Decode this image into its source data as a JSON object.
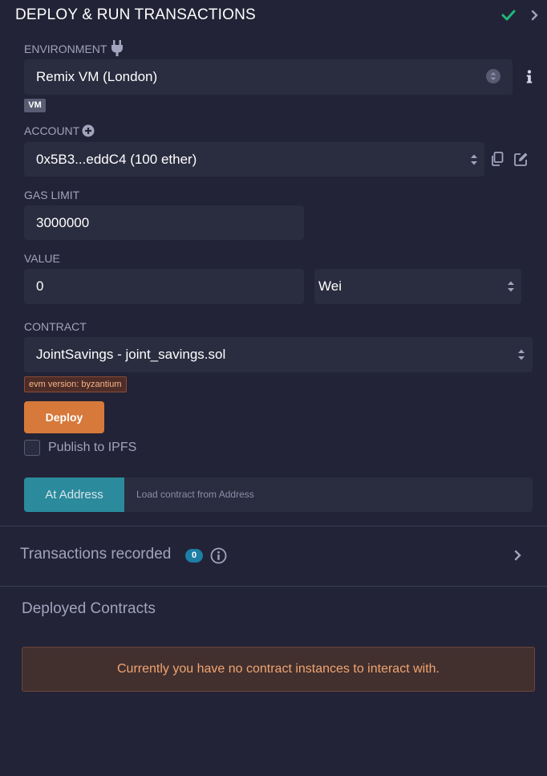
{
  "header": {
    "title": "DEPLOY & RUN TRANSACTIONS"
  },
  "environment": {
    "label": "ENVIRONMENT",
    "value": "Remix VM (London)",
    "badge": "VM"
  },
  "account": {
    "label": "ACCOUNT",
    "value": "0x5B3...eddC4 (100 ether)"
  },
  "gas_limit": {
    "label": "GAS LIMIT",
    "value": "3000000"
  },
  "value": {
    "label": "VALUE",
    "amount": "0",
    "unit": "Wei"
  },
  "contract": {
    "label": "CONTRACT",
    "value": "JointSavings - joint_savings.sol",
    "evm_badge": "evm version: byzantium"
  },
  "deploy": {
    "label": "Deploy",
    "publish_label": "Publish to IPFS",
    "publish_checked": false
  },
  "at_address": {
    "button_label": "At Address",
    "placeholder": "Load contract from Address"
  },
  "transactions": {
    "title": "Transactions recorded",
    "count": "0"
  },
  "deployed": {
    "title": "Deployed Contracts",
    "empty_message": "Currently you have no contract instances to interact with."
  },
  "colors": {
    "accent_deploy": "#d7793a",
    "accent_at_address": "#2b8a9b",
    "success": "#1fb87a",
    "background": "#222336"
  },
  "icons": [
    "check-icon",
    "chevron-right-icon",
    "plug-icon",
    "info-icon",
    "plus-circle-icon",
    "copy-icon",
    "edit-icon",
    "updown-icon"
  ]
}
